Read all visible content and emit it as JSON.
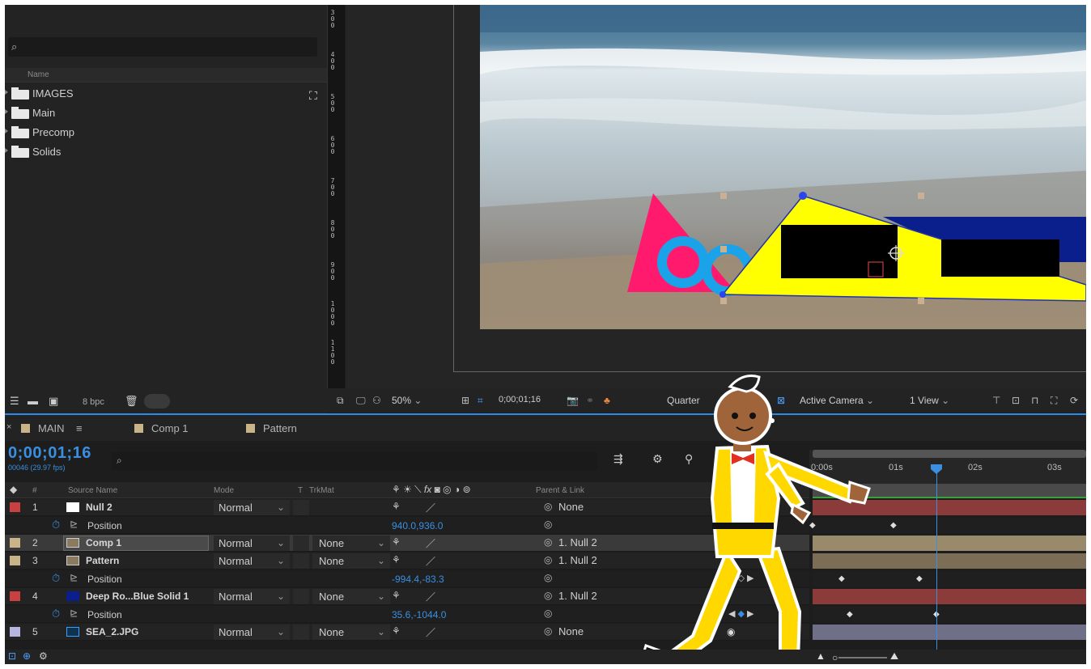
{
  "project": {
    "search_glyph": "⌕",
    "col_name": "Name",
    "items": [
      {
        "label": "IMAGES"
      },
      {
        "label": "Main"
      },
      {
        "label": "Precomp"
      },
      {
        "label": "Solids"
      }
    ],
    "bpc": "8 bpc"
  },
  "viewer_toolbar": {
    "zoom": "50%",
    "timecode": "0;00;01;16",
    "resolution": "Quarter",
    "camera": "Active Camera",
    "views": "1 View"
  },
  "tabs": [
    {
      "label": "MAIN",
      "color": "#c9b48a",
      "close": "×",
      "menu": "≡"
    },
    {
      "label": "Comp 1",
      "color": "#c9b48a"
    },
    {
      "label": "Pattern",
      "color": "#c9b48a"
    }
  ],
  "timeline": {
    "timecode": "0;00;01;16",
    "frames": "00046 (29.97 fps)",
    "columns": {
      "hash": "#",
      "source": "Source Name",
      "mode": "Mode",
      "t": "T",
      "trkmat": "TrkMat",
      "parent": "Parent & Link"
    },
    "time_labels": [
      "0:00s",
      "01s",
      "02s",
      "03s"
    ],
    "layers": [
      {
        "num": "1",
        "name": "Null 2",
        "mode": "Normal",
        "trkmat": "",
        "parent": "None",
        "color": "#c94040"
      },
      {
        "num": "2",
        "name": "Comp 1",
        "mode": "Normal",
        "trkmat": "None",
        "parent": "1. Null 2",
        "color": "#c9b48a"
      },
      {
        "num": "3",
        "name": "Pattern",
        "mode": "Normal",
        "trkmat": "None",
        "parent": "1. Null 2",
        "color": "#c9b48a"
      },
      {
        "num": "4",
        "name": "Deep Ro...Blue Solid 1",
        "mode": "Normal",
        "trkmat": "None",
        "parent": "1. Null 2",
        "color": "#c94040"
      },
      {
        "num": "5",
        "name": "SEA_2.JPG",
        "mode": "Normal",
        "trkmat": "None",
        "parent": "None",
        "color": "#b5b5e0"
      }
    ],
    "properties": [
      {
        "name": "Position",
        "value": "940.0,936.0"
      },
      {
        "name": "Position",
        "value": "-994.4,-83.3"
      },
      {
        "name": "Position",
        "value": "35.6,-1044.0"
      }
    ]
  },
  "colors": {
    "accent": "#3a8fe0",
    "pink_triangle": "#ff1a6e",
    "yellow_shape": "#ffff00",
    "blue_solid": "#0a1e8c",
    "cyan_ring": "#1aa3e8"
  }
}
